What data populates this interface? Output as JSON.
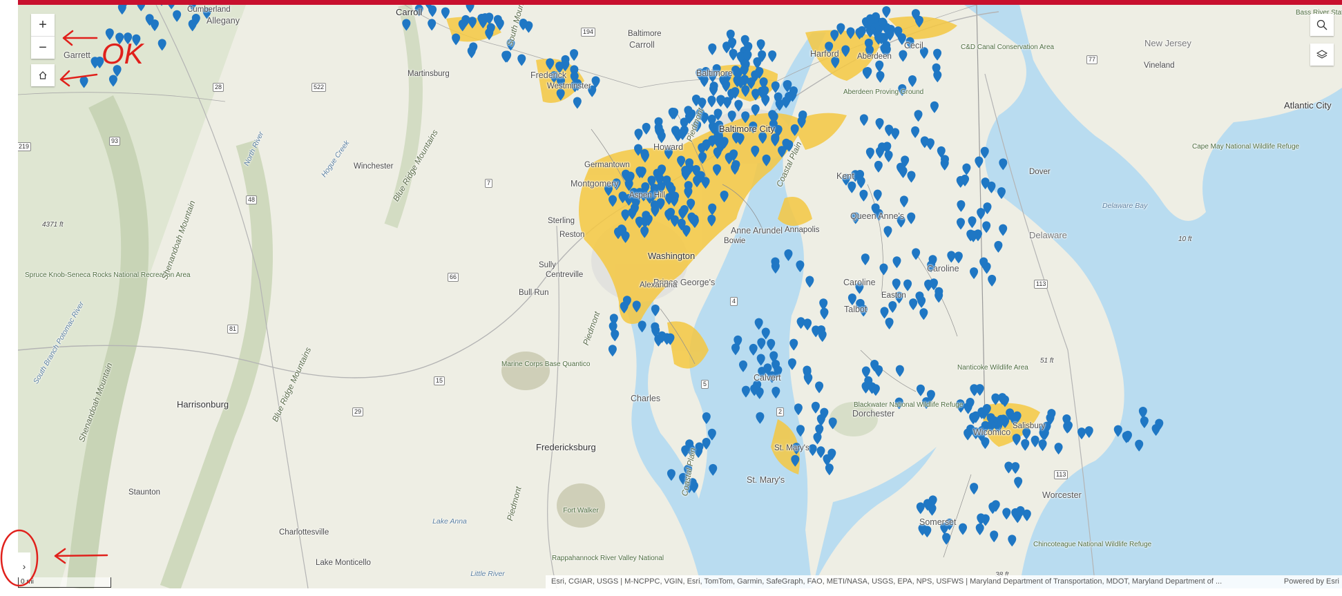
{
  "map": {
    "states": [
      "New Jersey",
      "Delaware"
    ],
    "cities": [
      "Washington",
      "Baltimore",
      "Baltimore City",
      "Annapolis",
      "Frederick",
      "Westminster",
      "Aberdeen",
      "Martinsburg",
      "Winchester",
      "Sterling",
      "Reston",
      "Sully",
      "Centreville",
      "Bull Run",
      "Harrisonburg",
      "Staunton",
      "Charlottesville",
      "Lake Monticello",
      "Fredericksburg",
      "Dover",
      "Vineland",
      "Atlantic City",
      "Bowie",
      "Easton",
      "Salisbury",
      "Germantown",
      "Aspen Hill",
      "Alexandria"
    ],
    "counties": [
      "Garrett",
      "Allegany",
      "Cumberland",
      "Washington",
      "Frederick",
      "Carroll",
      "Baltimore",
      "Harford",
      "Cecil",
      "Howard",
      "Montgomery",
      "Anne Arundel",
      "Prince George's",
      "Charles",
      "Calvert",
      "St. Mary's",
      "Kent",
      "Queen Anne's",
      "Caroline",
      "Talbot",
      "Dorchester",
      "Wicomico",
      "Worcester",
      "Somerset"
    ],
    "features": [
      "Blue Ridge Mountains",
      "Shenandoah Mountain",
      "South Mountain",
      "Piedmont",
      "Coastal Plain",
      "North River",
      "Hogue Creek",
      "Lake Anna",
      "Little River",
      "Delaware Bay",
      "Aberdeen Proving Ground",
      "C&D Canal Conservation Area",
      "Marine Corps Base Quantico",
      "Fort Walker",
      "Cape May National Wildlife Refuge",
      "Blackwater National Wildlife Refuge",
      "Nanticoke Wildlife Area",
      "Chincoteague National Wildlife Refuge",
      "Rappahannock River Valley National",
      "Spruce Knob-Seneca Rocks National Recreation Area",
      "South Branch Potomac River",
      "Bass River State F"
    ],
    "elevations": [
      "4371 ft",
      "51 ft",
      "10 ft",
      "38 ft"
    ],
    "route_shields": [
      "194",
      "28",
      "522",
      "93",
      "48",
      "7",
      "66",
      "81",
      "15",
      "29",
      "4",
      "5",
      "2",
      "113",
      "77",
      "219"
    ],
    "colors": {
      "water": "#b9dcf0",
      "land": "#eeeee4",
      "urban": "#f5c842",
      "marker": "#1f77c4",
      "header": "#c8102e"
    }
  },
  "controls": {
    "zoom_in": "+",
    "zoom_out": "−",
    "home": "home-icon",
    "search": "search-icon",
    "layers": "layers-icon",
    "expand": "›"
  },
  "scale": "0 mi",
  "attribution": "Esri, CGIAR, USGS | M-NCPPC, VGIN, Esri, TomTom, Garmin, SafeGraph, FAO, METI/NASA, USGS, EPA, NPS, USFWS | Maryland Department of Transportation, MDOT, Maryland Department of ...",
  "powered_by": "Powered by Esri",
  "annotations": {
    "ok_text": "OK"
  }
}
